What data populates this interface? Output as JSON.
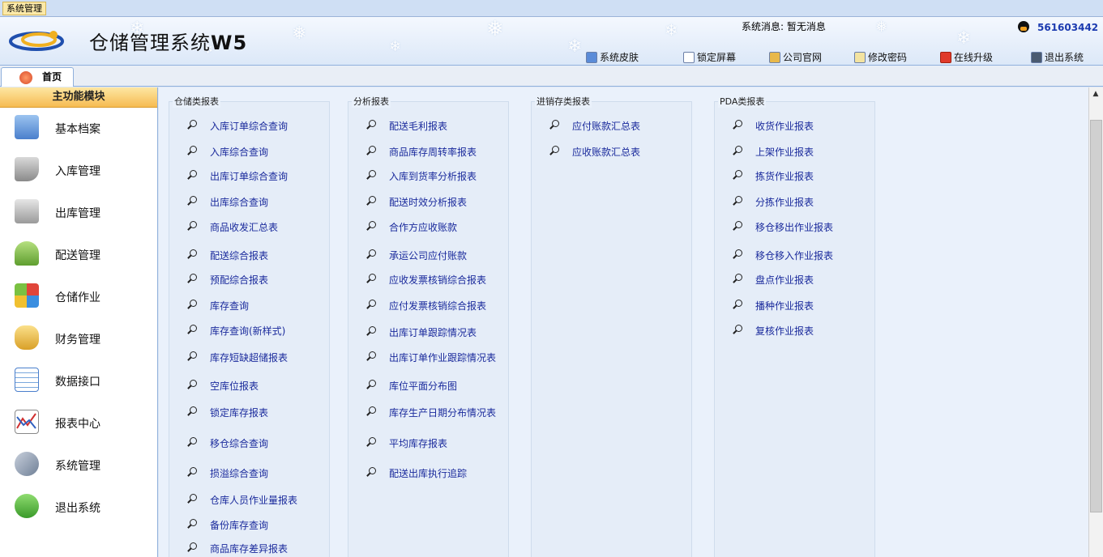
{
  "menubar": {
    "system_menu": "系统管理"
  },
  "header": {
    "app_title_cn": "仓储管理系统",
    "app_title_version": "W5",
    "system_message_label": "系统消息:",
    "system_message_value": "暂无消息",
    "qq_number": "561603442",
    "buttons": [
      {
        "label": "系统皮肤",
        "icon": "skin-icon"
      },
      {
        "label": "锁定屏幕",
        "icon": "lock-screen-icon"
      },
      {
        "label": "公司官网",
        "icon": "website-icon"
      },
      {
        "label": "修改密码",
        "icon": "edit-password-icon"
      },
      {
        "label": "在线升级",
        "icon": "upgrade-icon"
      },
      {
        "label": "退出系统",
        "icon": "exit-icon"
      }
    ]
  },
  "tabs": {
    "home": "首页"
  },
  "sidebar": {
    "title": "主功能模块",
    "items": [
      {
        "label": "基本档案",
        "icon": "archive-icon",
        "color": "#5b8fd6"
      },
      {
        "label": "入库管理",
        "icon": "cart-add-icon",
        "color": "#6aa84f"
      },
      {
        "label": "出库管理",
        "icon": "calculator-icon",
        "color": "#8e8e8e"
      },
      {
        "label": "配送管理",
        "icon": "distribution-arrow-icon",
        "color": "#7ab648"
      },
      {
        "label": "仓储作业",
        "icon": "grid-blocks-icon",
        "color": "#e06666"
      },
      {
        "label": "财务管理",
        "icon": "coins-icon",
        "color": "#e6b43c"
      },
      {
        "label": "数据接口",
        "icon": "data-table-icon",
        "color": "#4a86c8"
      },
      {
        "label": "报表中心",
        "icon": "report-chart-icon",
        "color": "#cc4a4a"
      },
      {
        "label": "系统管理",
        "icon": "tools-icon",
        "color": "#7f8fa6"
      },
      {
        "label": "退出系统",
        "icon": "exit-arrow-icon",
        "color": "#4aa84a"
      }
    ]
  },
  "groups": [
    {
      "title": "仓储类报表",
      "links": [
        "入库订单综合查询",
        "入库综合查询",
        "出库订单综合查询",
        "出库综合查询",
        "商品收发汇总表",
        "配送综合报表",
        "预配综合报表",
        "库存查询",
        "库存查询(新样式)",
        "库存短缺超储报表",
        "空库位报表",
        "锁定库存报表",
        "移仓综合查询",
        "损溢综合查询",
        "仓库人员作业量报表",
        "备份库存查询",
        "商品库存差异报表"
      ]
    },
    {
      "title": "分析报表",
      "links": [
        "配送毛利报表",
        "商品库存周转率报表",
        "入库到货率分析报表",
        "配送时效分析报表",
        "合作方应收账款",
        "承运公司应付账款",
        "应收发票核销综合报表",
        "应付发票核销综合报表",
        "出库订单跟踪情况表",
        "出库订单作业跟踪情况表",
        "库位平面分布图",
        "库存生产日期分布情况表",
        "平均库存报表",
        "配送出库执行追踪"
      ]
    },
    {
      "title": "进销存类报表",
      "links": [
        "应付账款汇总表",
        "应收账款汇总表"
      ]
    },
    {
      "title": "PDA类报表",
      "links": [
        "收货作业报表",
        "上架作业报表",
        "拣货作业报表",
        "分拣作业报表",
        "移仓移出作业报表",
        "移仓移入作业报表",
        "盘点作业报表",
        "播种作业报表",
        "复核作业报表"
      ]
    }
  ]
}
